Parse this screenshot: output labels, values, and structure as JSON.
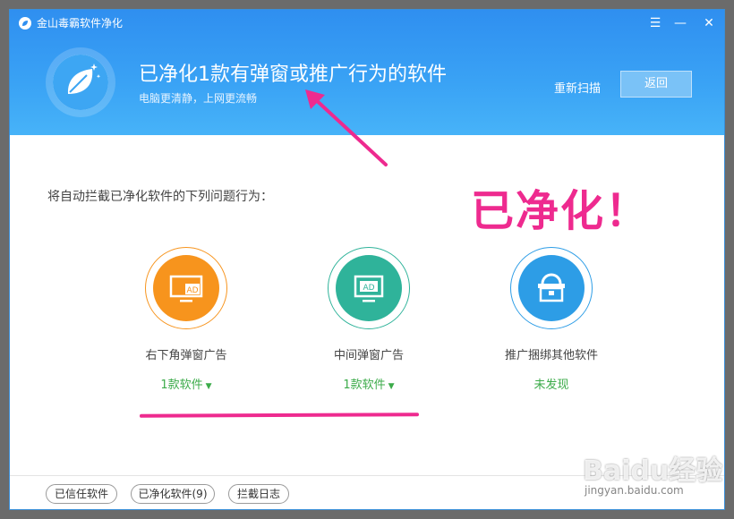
{
  "window": {
    "app_title": "金山毒霸软件净化",
    "menu_icon_glyph": "☰",
    "minimize_glyph": "—",
    "close_glyph": "✕"
  },
  "header": {
    "title": "已净化1款有弹窗或推广行为的软件",
    "subtitle": "电脑更清静，上网更流畅",
    "rescan_label": "重新扫描",
    "back_label": "返回"
  },
  "content": {
    "intro_text": "将自动拦截已净化软件的下列问题行为：",
    "annotation_text": "已净化！",
    "features": [
      {
        "label": "右下角弹窗广告",
        "status": "1款软件",
        "dropdown_glyph": "▼",
        "color": "#f7941d",
        "icon": "monitor-ad-icon",
        "icon_text": "AD"
      },
      {
        "label": "中间弹窗广告",
        "status": "1款软件",
        "dropdown_glyph": "▼",
        "color": "#2fb39a",
        "icon": "popup-ad-icon",
        "icon_text": "AD"
      },
      {
        "label": "推广捆绑其他软件",
        "status": "未发现",
        "color": "#2d9de6",
        "icon": "bundle-box-icon"
      }
    ]
  },
  "footer": {
    "trusted_label": "已信任软件",
    "cleaned_label": "已净化软件(9)",
    "log_label": "拦截日志"
  },
  "watermark": {
    "logo_text": "Baidu经验",
    "url_text": "jingyan.baidu.com"
  },
  "colors": {
    "header_blue": "#2f8ff0",
    "accent_pink": "#ee2a8f",
    "status_green": "#3cab4a"
  }
}
